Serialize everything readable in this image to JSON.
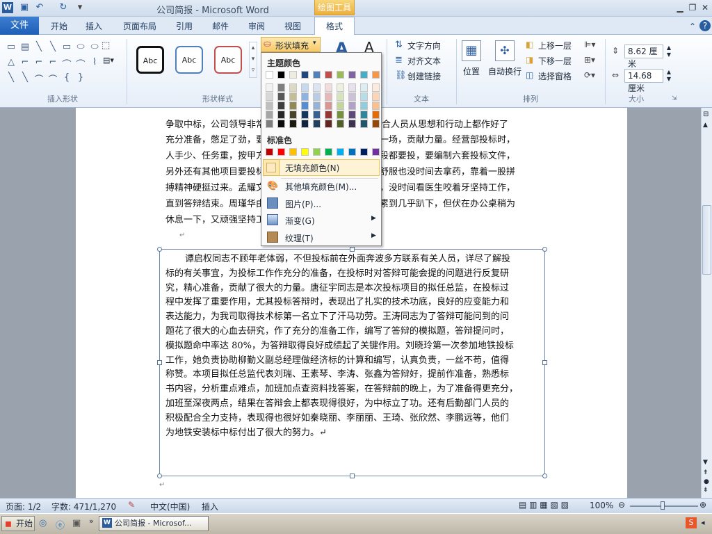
{
  "window": {
    "title": "公司简报 - Microsoft Word",
    "context_tab": "绘图工具"
  },
  "tabs": [
    "文件",
    "开始",
    "插入",
    "页面布局",
    "引用",
    "邮件",
    "审阅",
    "视图",
    "格式"
  ],
  "ribbon": {
    "groups": [
      "插入形状",
      "形状样式",
      "文本",
      "排列",
      "大小"
    ],
    "style_samples": [
      "Abc",
      "Abc",
      "Abc"
    ],
    "fill_button": "形状填充",
    "text_group": [
      "文字方向",
      "对齐文本",
      "创建链接"
    ],
    "arrange": [
      "位置",
      "自动换行",
      "上移一层",
      "下移一层",
      "选择窗格"
    ],
    "size": {
      "height": "8.62 厘米",
      "width": "14.68 厘米"
    }
  },
  "fill_menu": {
    "theme_colors_label": "主题颜色",
    "standard_colors_label": "标准色",
    "items": [
      "无填充颜色(N)",
      "其他填充颜色(M)...",
      "图片(P)...",
      "渐变(G)",
      "纹理(T)"
    ],
    "theme_top": [
      "#ffffff",
      "#000000",
      "#eeece1",
      "#1f497d",
      "#4f81bd",
      "#c0504d",
      "#9bbb59",
      "#8064a2",
      "#4bacc6",
      "#f79646"
    ],
    "theme_columns": [
      [
        "#f2f2f2",
        "#d8d8d8",
        "#bfbfbf",
        "#a5a5a5",
        "#7f7f7f"
      ],
      [
        "#7f7f7f",
        "#595959",
        "#3f3f3f",
        "#262626",
        "#0c0c0c"
      ],
      [
        "#ddd9c3",
        "#c4bd97",
        "#938953",
        "#494429",
        "#1d1b10"
      ],
      [
        "#c6d9f0",
        "#8db3e2",
        "#548dd4",
        "#17365d",
        "#0f243e"
      ],
      [
        "#dbe5f1",
        "#b8cce4",
        "#95b3d7",
        "#366092",
        "#244061"
      ],
      [
        "#f2dcdb",
        "#e5b9b7",
        "#d99694",
        "#953734",
        "#632423"
      ],
      [
        "#ebf1dd",
        "#d7e3bc",
        "#c3d69b",
        "#76923c",
        "#4f6128"
      ],
      [
        "#e5e0ec",
        "#ccc1d9",
        "#b2a2c7",
        "#5f497a",
        "#3f3151"
      ],
      [
        "#dbeef3",
        "#b7dde8",
        "#92cddc",
        "#31859b",
        "#205867"
      ],
      [
        "#fdeada",
        "#fbd5b5",
        "#fac08f",
        "#e36c09",
        "#974806"
      ]
    ],
    "standard": [
      "#c00000",
      "#ff0000",
      "#ffc000",
      "#ffff00",
      "#92d050",
      "#00b050",
      "#00b0f0",
      "#0070c0",
      "#002060",
      "#7030a0"
    ]
  },
  "doc": {
    "upper_lines": [
      "争取中标，公司领导非常",
      "员和配合人员从思想和行动上都作好了",
      "充分准备，憋足了劲，要",
      "大干一场，贡献力量。经营部投标时，",
      "人手少、任务重，按甲方",
      "个标段都要投，要编制六套投标文件，",
      "另外还有其他项目要投标",
      "体不舒服也没时间去拿药，靠着一股拼",
      "搏精神硬挺过来。孟耀文",
      "紧张，没时间看医生咬着牙坚持工作，",
      "直到答辩结束。周瑾华由",
      "点，累到几乎趴下，但伏在办公桌稍为",
      "休息一下，又顽强坚持工"
    ],
    "textbox_lines": [
      "谭启权同志不顾年老体弱，不但投标前在外面奔波多方联系有关人员，详尽了解投",
      "标的有关事宜，为投标工作作充分的准备，在投标时对答辩可能会提的问题进行反复研",
      "究，精心准备，贡献了很大的力量。唐征宇同志是本次投标项目的拟任总监，在投标过",
      "程中发挥了重要作用，尤其投标答辩时，表现出了扎实的技术功底，良好的应变能力和",
      "表达能力，为我司取得技术标第一名立下了汗马功劳。王涛同志为了答辩可能问到的问",
      "题花了很大的心血去研究，作了充分的准备工作，编写了答辩的模拟题，答辩提问时，",
      "模拟题命中率达 80%，为答辩取得良好成绩起了关键作用。刘晓玲第一次参加地铁投标",
      "工作，她负责协助柳勤义副总经理做经济标的计算和编写，认真负责，一丝不苟，值得",
      "称赞。本项目拟任总监代表刘瑞、王素琴、李涛、张鑫为答辩好，提前作准备，熟悉标",
      "书内容，分析重点难点，加班加点查资料找答案，在答辩前的晚上，为了准备得更充分，",
      "加班至深夜两点，结果在答辩会上都表现得很好，为中标立了功。还有后勤部门人员的",
      "积极配合全力支持，表现得也很好如秦晓丽、李丽丽、王琦、张欣然、李鹏远等，他们",
      "为地铁安装标中标付出了很大的努力。↵"
    ]
  },
  "status": {
    "page": "页面: 1/2",
    "words": "字数: 471/1,270",
    "lang": "中文(中国)",
    "mode": "插入",
    "zoom": "100%"
  },
  "taskbar": {
    "start": "开始",
    "window": "公司简报 - Microsof..."
  }
}
